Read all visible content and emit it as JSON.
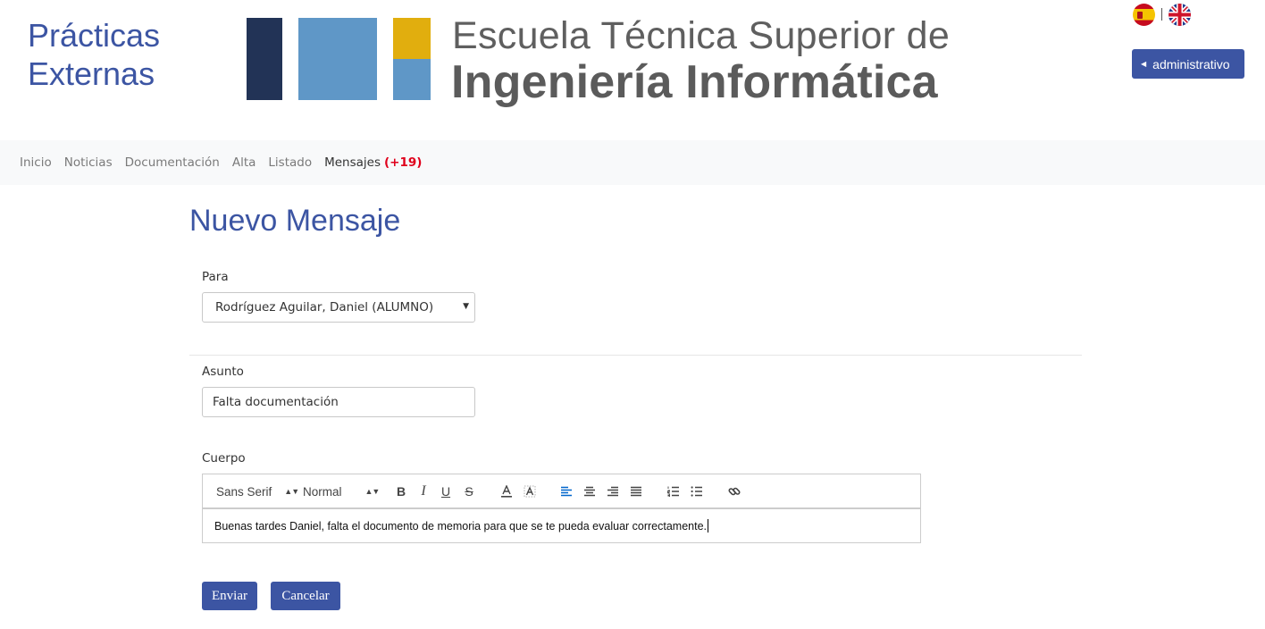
{
  "header": {
    "site_title": "Prácticas Externas",
    "logo_line1": "Escuela Técnica Superior de",
    "logo_line2": "Ingeniería Informática",
    "languages": [
      "Español",
      "English"
    ],
    "user_button": "administrativo"
  },
  "nav": {
    "items": [
      {
        "label": "Inicio"
      },
      {
        "label": "Noticias"
      },
      {
        "label": "Documentación"
      },
      {
        "label": "Alta"
      },
      {
        "label": "Listado"
      },
      {
        "label": "Mensajes",
        "count": "(+19)"
      }
    ],
    "active": "Mensajes"
  },
  "form": {
    "title": "Nuevo Mensaje",
    "to_label": "Para",
    "to_value": "Rodríguez Aguilar, Daniel (ALUMNO)",
    "subject_label": "Asunto",
    "subject_value": "Falta documentación",
    "body_label": "Cuerpo",
    "editor": {
      "font_picker": "Sans Serif",
      "size_picker": "Normal",
      "body_text": "Buenas tardes Daniel, falta el documento de memoria para que se te pueda evaluar correctamente."
    },
    "send_button": "Enviar",
    "cancel_button": "Cancelar"
  },
  "colors": {
    "brand": "#3c55a3",
    "nav_count": "#e0001b",
    "logo_dark": "#223356",
    "logo_blue": "#5f97c7",
    "logo_yellow": "#e1ae0e"
  },
  "icons": [
    "spain-flag-icon",
    "uk-flag-icon",
    "caret-left-icon",
    "bold-icon",
    "italic-icon",
    "underline-icon",
    "strike-icon",
    "text-color-icon",
    "background-color-icon",
    "align-left-icon",
    "align-center-icon",
    "align-right-icon",
    "align-justify-icon",
    "ordered-list-icon",
    "bullet-list-icon",
    "link-icon"
  ]
}
